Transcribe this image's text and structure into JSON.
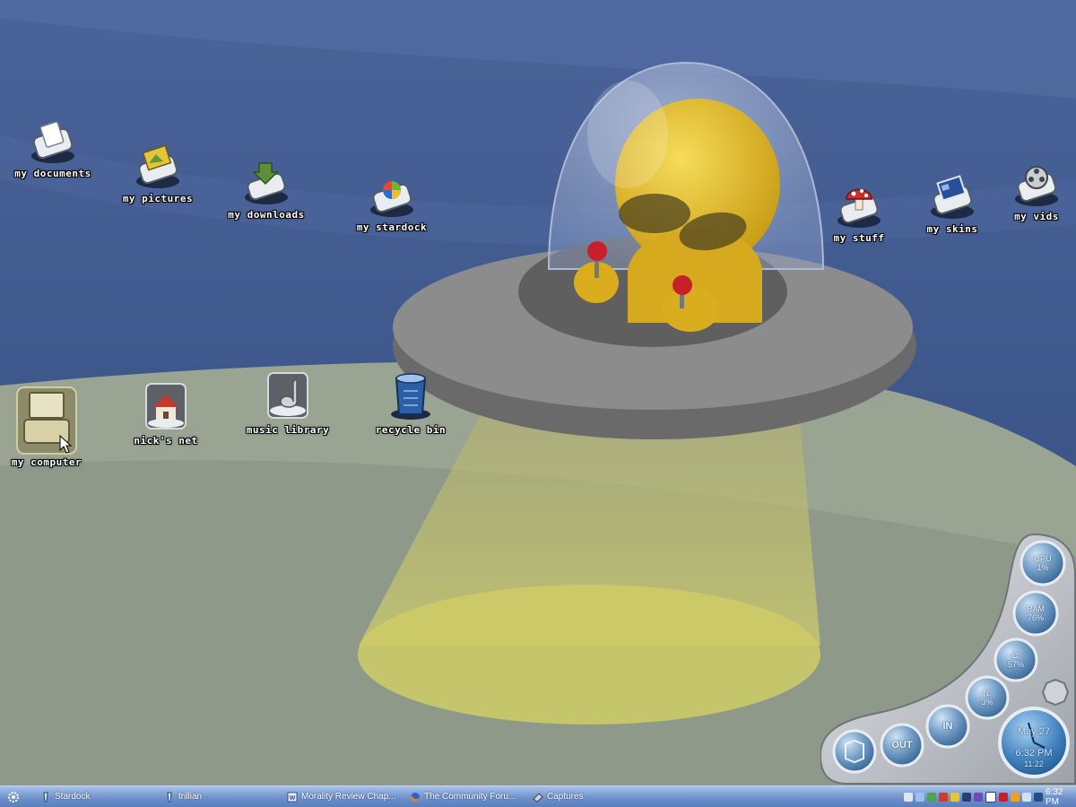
{
  "desktop": {
    "icons": [
      {
        "label": "my documents",
        "icon": "documents-icon"
      },
      {
        "label": "my pictures",
        "icon": "pictures-icon"
      },
      {
        "label": "my downloads",
        "icon": "downloads-icon"
      },
      {
        "label": "my stardock",
        "icon": "stardock-icon"
      },
      {
        "label": "my stuff",
        "icon": "mushroom-icon"
      },
      {
        "label": "my skins",
        "icon": "skins-icon"
      },
      {
        "label": "my vids",
        "icon": "film-reel-icon"
      },
      {
        "label": "my computer",
        "icon": "computer-icon"
      },
      {
        "label": "nick's net",
        "icon": "house-icon"
      },
      {
        "label": "music library",
        "icon": "music-icon"
      },
      {
        "label": "recycle bin",
        "icon": "recycle-bin-icon"
      }
    ]
  },
  "meters": {
    "cpu": {
      "label": "CPU",
      "value": "1%"
    },
    "ram": {
      "label": "RAM",
      "value": "76%"
    },
    "drive_c": {
      "label": "C:",
      "value": "57%"
    },
    "drive_n": {
      "label": "N:",
      "value": "3%"
    },
    "in_label": "IN",
    "out_label": "OUT",
    "clock_date": "May 27",
    "clock_time": "6:32 PM",
    "clock_sub": "11:22"
  },
  "taskbar": {
    "items": [
      {
        "label": "Stardock",
        "icon": "stardock-app-icon"
      },
      {
        "label": "trillian",
        "icon": "trillian-icon"
      },
      {
        "label": "Morality Review Chap...",
        "icon": "word-document-icon"
      },
      {
        "label": "The Community Foru...",
        "icon": "firefox-icon"
      },
      {
        "label": "Captures",
        "icon": "captures-icon"
      }
    ],
    "clock": "6:32 PM"
  },
  "colors": {
    "sky": "#3f5a8f",
    "ground": "#8f9a8a",
    "beam": "#c9c86a",
    "alien": "#e3be2e",
    "taskbar": "#6f91cc"
  }
}
